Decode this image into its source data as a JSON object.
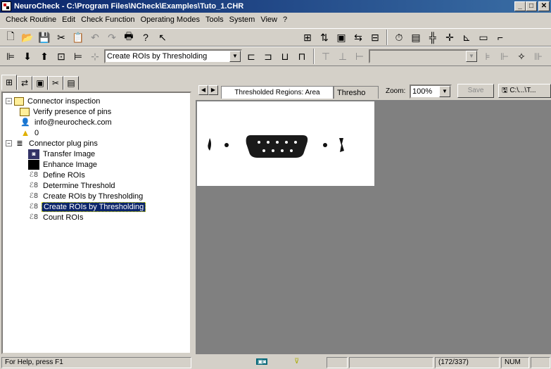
{
  "window": {
    "title": "NeuroCheck - C:\\Program Files\\NCheck\\Examples\\Tuto_1.CHR",
    "minimize": "_",
    "maximize": "□",
    "close": "✕"
  },
  "menu": [
    {
      "label": "Check Routine",
      "u": "C"
    },
    {
      "label": "Edit",
      "u": "E"
    },
    {
      "label": "Check Function",
      "u": "F"
    },
    {
      "label": "Operating Modes",
      "u": "O"
    },
    {
      "label": "Tools",
      "u": "T"
    },
    {
      "label": "System",
      "u": "S"
    },
    {
      "label": "View",
      "u": "V"
    },
    {
      "label": "?",
      "u": "?"
    }
  ],
  "toolbar2": {
    "function_combo": "Create ROIs by Thresholding"
  },
  "tree": {
    "items": [
      {
        "label": "Connector inspection"
      },
      {
        "label": "Verify presence of pins"
      },
      {
        "label": "info@neurocheck.com"
      },
      {
        "label": "0"
      },
      {
        "label": "Connector plug pins"
      },
      {
        "label": "Transfer Image"
      },
      {
        "label": "Enhance Image"
      },
      {
        "label": "Define ROIs"
      },
      {
        "label": "Determine Threshold"
      },
      {
        "label": "Create ROIs by Thresholding"
      },
      {
        "label": "Create ROIs by Thresholding"
      },
      {
        "label": "Count ROIs"
      }
    ]
  },
  "viewer": {
    "tab1": "Thresholded Regions: Area",
    "tab2": "Thresho",
    "zoom_label": "Zoom:",
    "zoom_value": "100%",
    "save_label": "Save",
    "path_label": "C:\\...\\T..."
  },
  "status": {
    "help": "For Help, press F1",
    "position": "(172/337)",
    "num": "NUM"
  }
}
